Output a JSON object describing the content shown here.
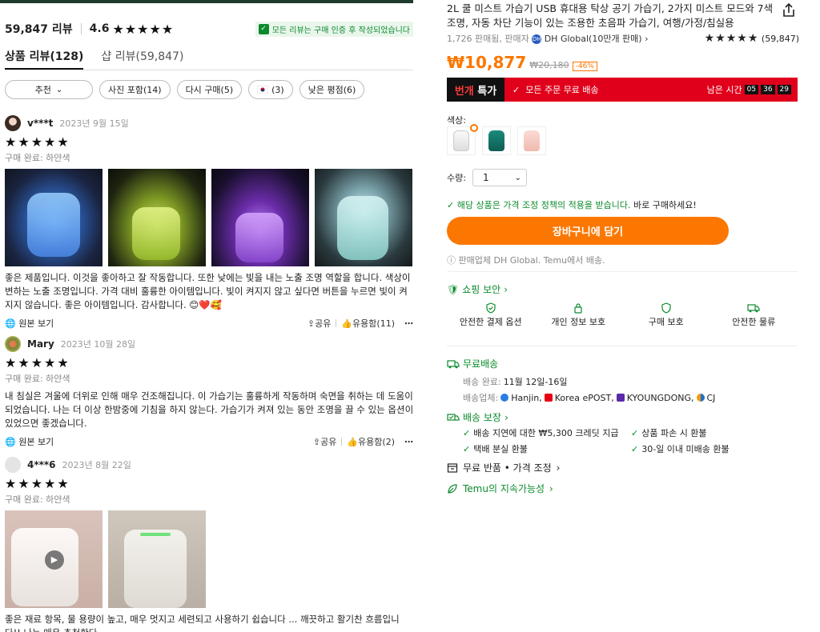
{
  "reviews_summary": {
    "count_label": "59,847 리뷰",
    "rating": "4.6",
    "verified_note": "모든 리뷰는 구매 인증 후 작성되었습니다"
  },
  "tabs": [
    {
      "label": "상품 리뷰(128)"
    },
    {
      "label": "샵 리뷰(59,847)"
    }
  ],
  "filters": [
    {
      "label": "추천"
    },
    {
      "label": "사진 포함(14)"
    },
    {
      "label": "다시 구매(5)"
    },
    {
      "label": "(3)"
    },
    {
      "label": "낮은 평점(6)"
    }
  ],
  "reviews": [
    {
      "user": "v***t",
      "date": "2023년 9월 15일",
      "stars": "★★★★★",
      "spec": "구매 완료: 하얀색",
      "text": "좋은 제품입니다. 이것을 좋아하고 잘 작동합니다. 또한 낮에는 빛을 내는 노출 조명 역할을 합니다. 색상이 변하는 노출 조명입니다. 가격 대비 훌륭한 아이템입니다. 빛이 켜지지 않고 싶다면 버튼을 누르면 빛이 켜지지 않습니다. 좋은 아이템입니다. 감사합니다. 😊❤️🥰",
      "original_label": "원본 보기",
      "share": "공유",
      "helpful": "유용함(11)"
    },
    {
      "user": "Mary",
      "date": "2023년 10월 28일",
      "stars": "★★★★★",
      "spec": "구매 완료: 하얀색",
      "text": "내 침실은 겨울에 더위로 인해 매우 건조해집니다. 이 가습기는 훌륭하게 작동하며 숙면을 취하는 데 도움이 되었습니다. 나는 더 이상 한밤중에 기침을 하지 않는다. 가습기가 켜져 있는 동안 조명을 끌 수 있는 옵션이 있었으면 좋겠습니다.",
      "original_label": "원본 보기",
      "share": "공유",
      "helpful": "유용함(2)"
    },
    {
      "user": "4***6",
      "date": "2023년 8월 22일",
      "stars": "★★★★★",
      "spec": "구매 완료: 하얀색",
      "text": "좋은 재료 항목, 물 용량이 높고, 매우 멋지고 세련되고 사용하기 쉽습니다 ... 깨끗하고 활기찬 흐름입니다!! 나는 매우 추천한다"
    }
  ],
  "product": {
    "title": "2L 쿨 미스트 가습기 USB 휴대용 탁상 공기 가습기, 2가지 미스트 모드와 7색 조명, 자동 차단 기능이 있는 조용한 초음파 가습기, 여행/가정/침실용",
    "sold": "1,726 판매됨, 판매자",
    "seller": "DH Global(10만개 판매)",
    "rating_count": "(59,847)",
    "price": "₩10,877",
    "original_price": "₩20,180",
    "discount": "-46%",
    "deal_badge_a": "번개",
    "deal_badge_b": "특가",
    "free_shipping": "모든 주문 무료 배송",
    "remaining": "남은 시간",
    "timer_h": "05",
    "timer_m": "36",
    "timer_s": "29",
    "color_label": "색상:",
    "qty_label": "수량:",
    "qty_value": "1",
    "price_policy": "해당 상품은 가격 조정 정책의 적용을 받습니다.",
    "buy_now": "바로 구매하세요!",
    "cart_button": "장바구니에 담기",
    "seller_note": "판매업체 DH Global. Temu에서 배송."
  },
  "security": {
    "title": "쇼핑 보안",
    "items": [
      {
        "label": "안전한 결제 옵션"
      },
      {
        "label": "개인 정보 보호"
      },
      {
        "label": "구매 보호"
      },
      {
        "label": "안전한 물류"
      }
    ]
  },
  "shipping": {
    "title": "무료배송",
    "delivery_label": "배송 완료:",
    "delivery_value": "11월 12일-16일",
    "carrier_label": "배송업체:",
    "carriers": [
      "Hanjin,",
      "Korea ePOST,",
      "KYOUNGDONG,",
      "CJ"
    ]
  },
  "guarantee": {
    "title": "배송 보장",
    "items": [
      {
        "label": "배송 지연에 대한 ₩5,300 크레딧 지급"
      },
      {
        "label": "상품 파손 시 환불"
      },
      {
        "label": "택배 분실 환불"
      },
      {
        "label": "30-일 이내 미배송 환불"
      }
    ]
  },
  "returns": {
    "label": "무료 반품 • 가격 조정"
  },
  "sustainability": {
    "label": "Temu의 지속가능성"
  },
  "colors": {
    "accent": "#fb7701",
    "green": "#0a8a2c",
    "deal_red": "#e0001b"
  }
}
